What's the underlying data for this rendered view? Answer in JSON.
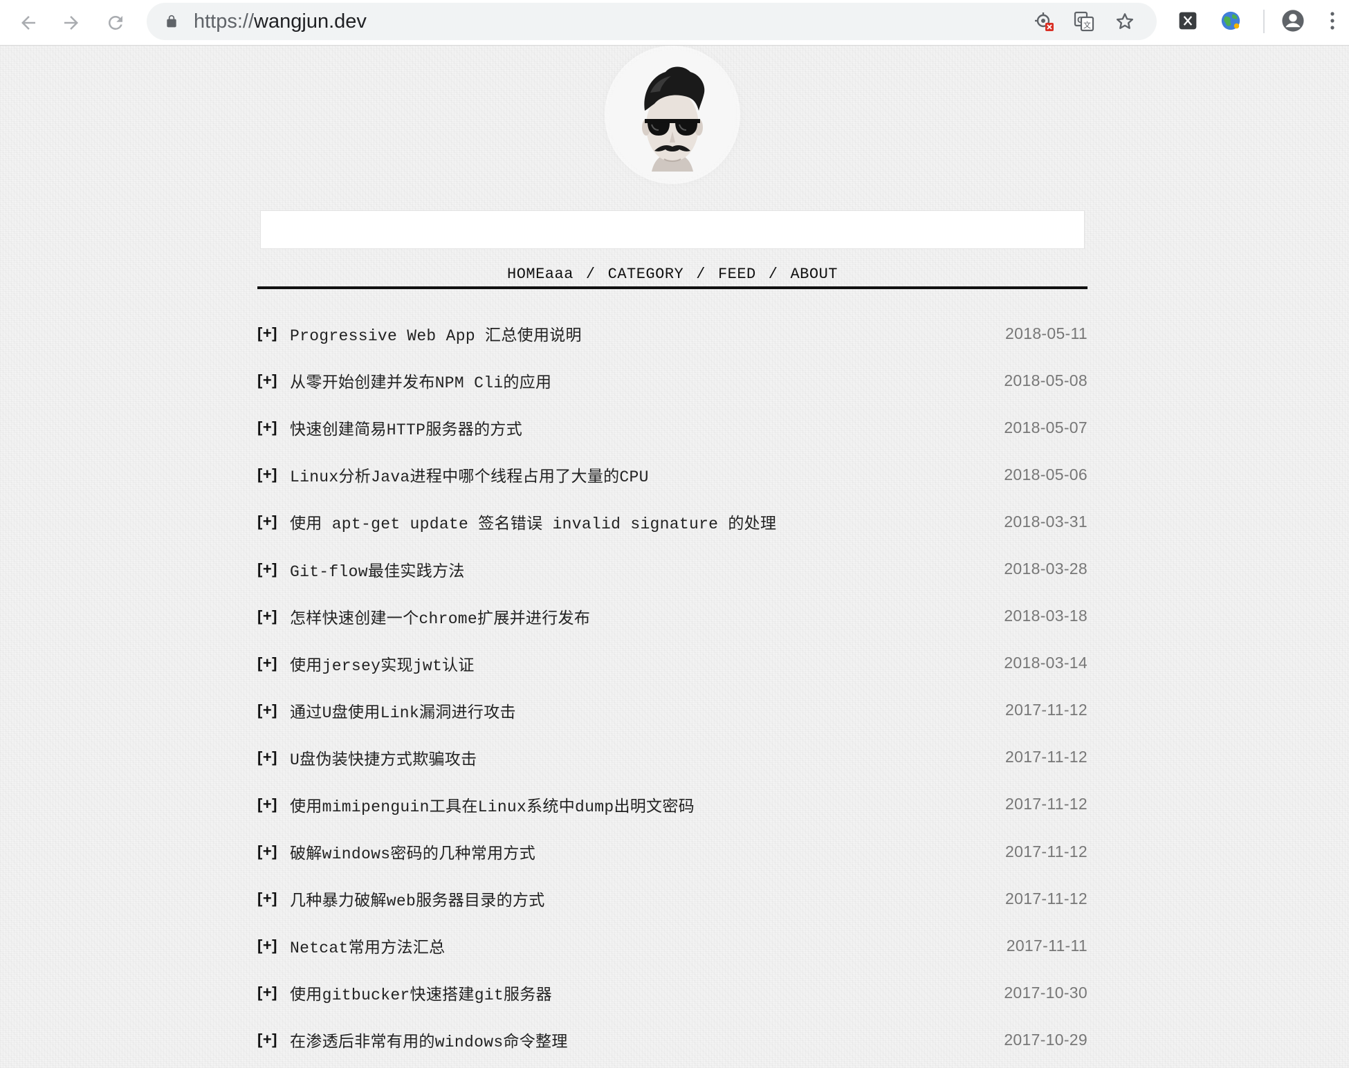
{
  "browser": {
    "url_scheme": "https://",
    "url_host": "wangjun.dev",
    "icons": {
      "back": "back-arrow-icon",
      "forward": "forward-arrow-icon",
      "reload": "reload-icon",
      "lock": "lock-icon",
      "blocked": "location-blocked-icon",
      "translate": "translate-icon",
      "bookmark": "star-icon",
      "ext1": "x-extension-icon",
      "ext2": "globe-extension-icon",
      "profile": "profile-icon",
      "menu": "kebab-menu-icon"
    }
  },
  "page": {
    "avatar": "avatar-sunglasses-mustache",
    "search_placeholder": "",
    "menu": {
      "home": "HOMEaaa",
      "category": "CATEGORY",
      "feed": "FEED",
      "about": "ABOUT",
      "separator": "/"
    },
    "toggle": "[+]",
    "posts": [
      {
        "title": "Progressive Web App 汇总使用说明",
        "date": "2018-05-11"
      },
      {
        "title": "从零开始创建并发布NPM Cli的应用",
        "date": "2018-05-08"
      },
      {
        "title": "快速创建简易HTTP服务器的方式",
        "date": "2018-05-07"
      },
      {
        "title": "Linux分析Java进程中哪个线程占用了大量的CPU",
        "date": "2018-05-06"
      },
      {
        "title": "使用 apt-get update 签名错误 invalid signature 的处理",
        "date": "2018-03-31"
      },
      {
        "title": "Git-flow最佳实践方法",
        "date": "2018-03-28"
      },
      {
        "title": "怎样快速创建一个chrome扩展并进行发布",
        "date": "2018-03-18"
      },
      {
        "title": "使用jersey实现jwt认证",
        "date": "2018-03-14"
      },
      {
        "title": "通过U盘使用Link漏洞进行攻击",
        "date": "2017-11-12"
      },
      {
        "title": "U盘伪装快捷方式欺骗攻击",
        "date": "2017-11-12"
      },
      {
        "title": "使用mimipenguin工具在Linux系统中dump出明文密码",
        "date": "2017-11-12"
      },
      {
        "title": "破解windows密码的几种常用方式",
        "date": "2017-11-12"
      },
      {
        "title": "几种暴力破解web服务器目录的方式",
        "date": "2017-11-12"
      },
      {
        "title": "Netcat常用方法汇总",
        "date": "2017-11-11"
      },
      {
        "title": "使用gitbucker快速搭建git服务器",
        "date": "2017-10-30"
      },
      {
        "title": "在渗透后非常有用的windows命令整理",
        "date": "2017-10-29"
      }
    ]
  }
}
